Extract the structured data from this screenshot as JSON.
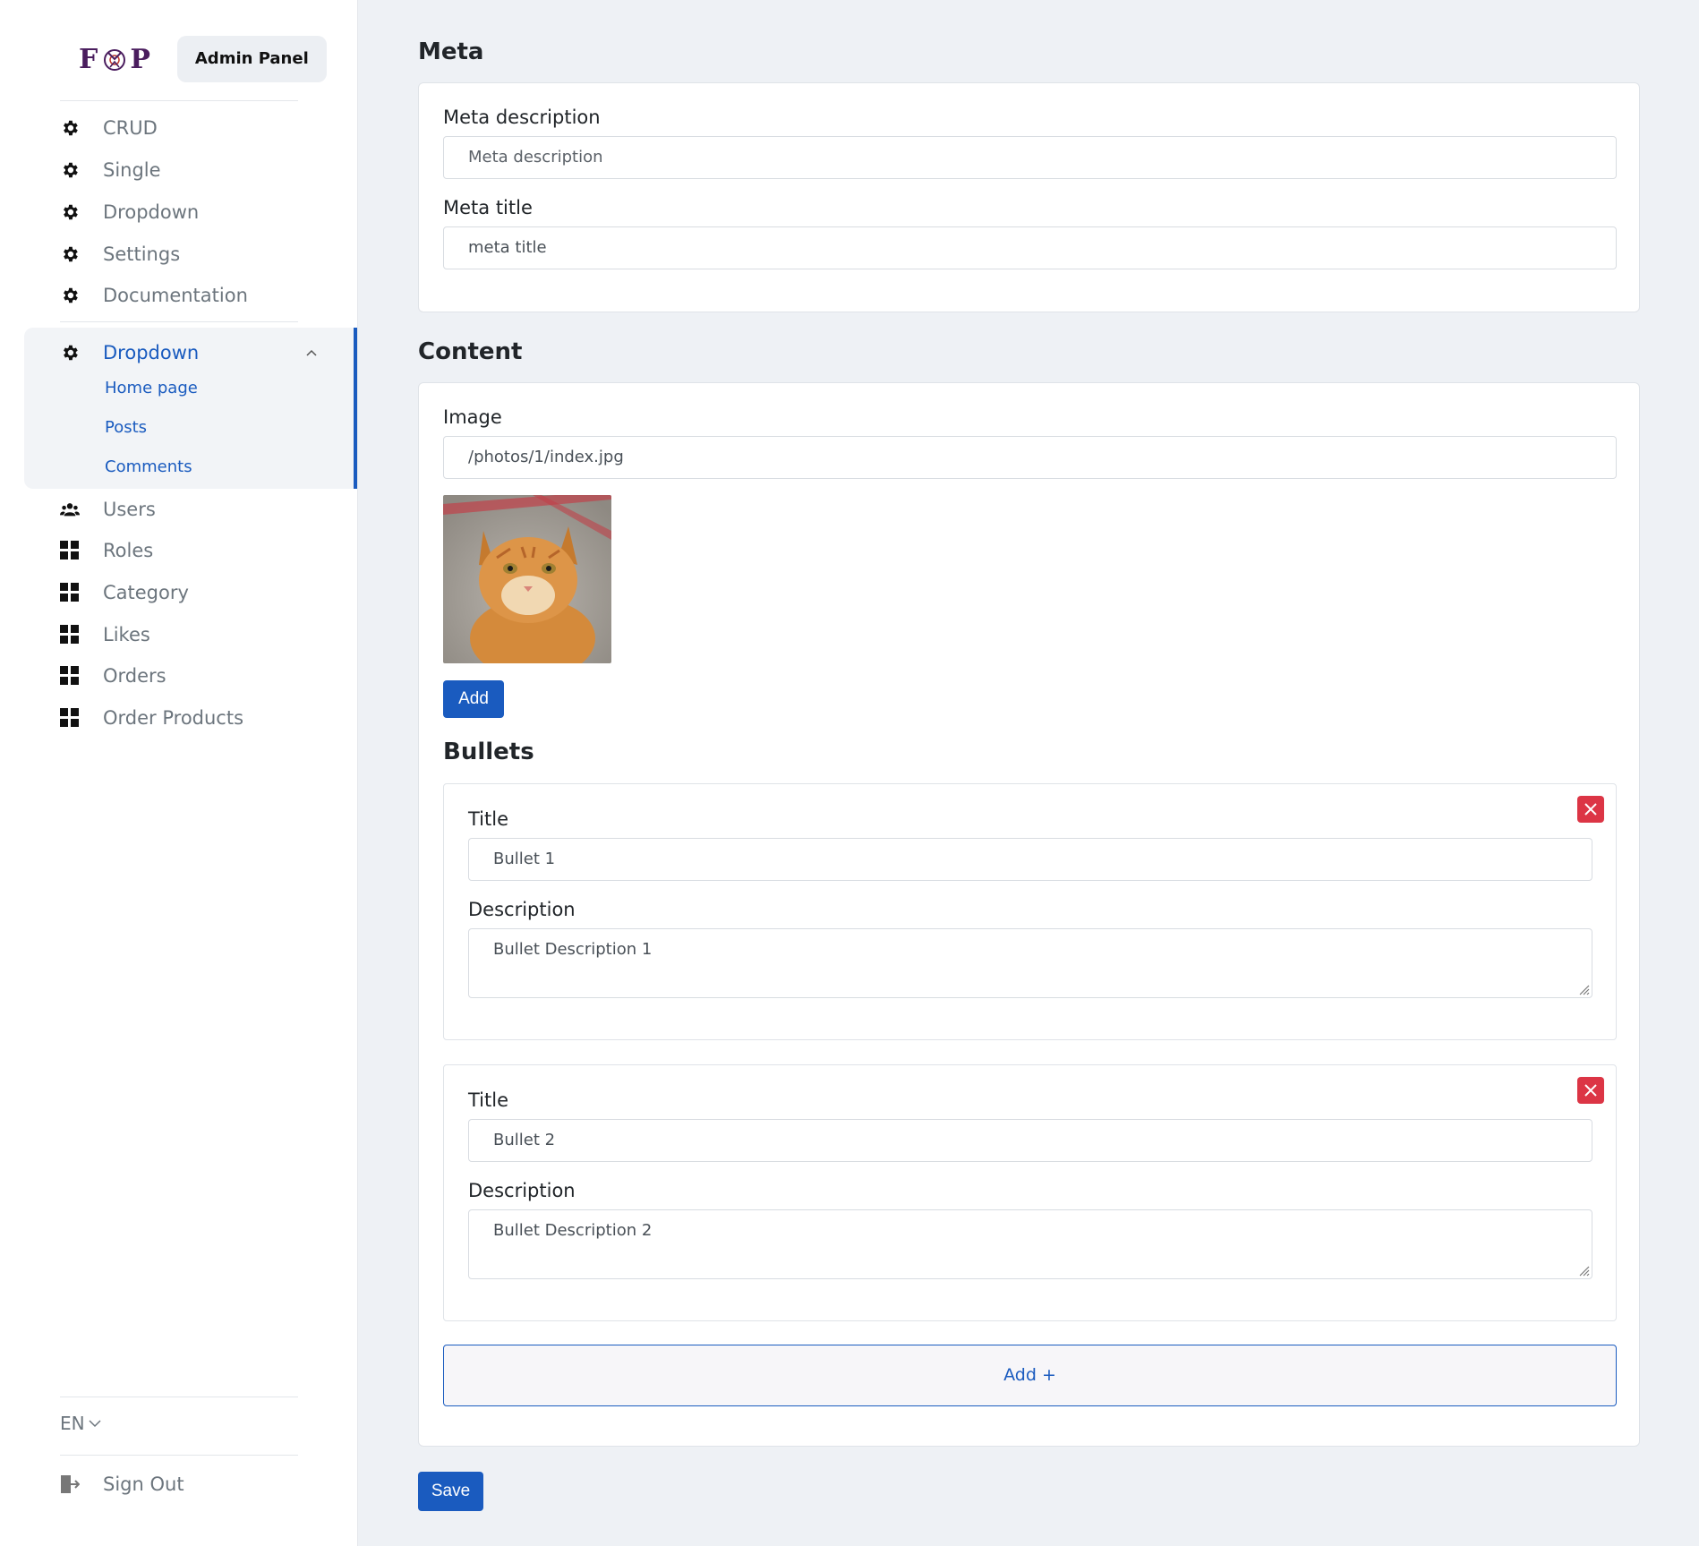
{
  "sidebar": {
    "logo_text_left": "F",
    "logo_text_right": "P",
    "admin_badge": "Admin Panel",
    "items": [
      {
        "label": "CRUD",
        "icon": "gear-icon"
      },
      {
        "label": "Single",
        "icon": "gear-icon"
      },
      {
        "label": "Dropdown",
        "icon": "gear-icon"
      },
      {
        "label": "Settings",
        "icon": "gear-icon"
      },
      {
        "label": "Documentation",
        "icon": "gear-icon"
      }
    ],
    "dropdown": {
      "label": "Dropdown",
      "icon": "gear-icon",
      "sub_items": [
        "Home page",
        "Posts",
        "Comments"
      ]
    },
    "items2": [
      {
        "label": "Users",
        "icon": "users-icon"
      },
      {
        "label": "Roles",
        "icon": "grid-icon"
      },
      {
        "label": "Category",
        "icon": "grid-icon"
      },
      {
        "label": "Likes",
        "icon": "grid-icon"
      },
      {
        "label": "Orders",
        "icon": "grid-icon"
      },
      {
        "label": "Order Products",
        "icon": "grid-icon"
      }
    ],
    "language": "EN",
    "sign_out": "Sign Out"
  },
  "meta": {
    "heading": "Meta",
    "description_label": "Meta description",
    "description_placeholder": "Meta description",
    "title_label": "Meta title",
    "title_value": "meta title"
  },
  "content": {
    "heading": "Content",
    "image_label": "Image",
    "image_value": "/photos/1/index.jpg",
    "add_button": "Add",
    "bullets_heading": "Bullets",
    "bullets": [
      {
        "title_label": "Title",
        "title_value": "Bullet 1",
        "description_label": "Description",
        "description_value": "Bullet Description 1"
      },
      {
        "title_label": "Title",
        "title_value": "Bullet 2",
        "description_label": "Description",
        "description_value": "Bullet Description 2"
      }
    ],
    "add_bullet_button": "Add +"
  },
  "save_button": "Save",
  "colors": {
    "primary": "#1a5bbf",
    "danger": "#dc3545",
    "logo": "#4a1d5e"
  }
}
